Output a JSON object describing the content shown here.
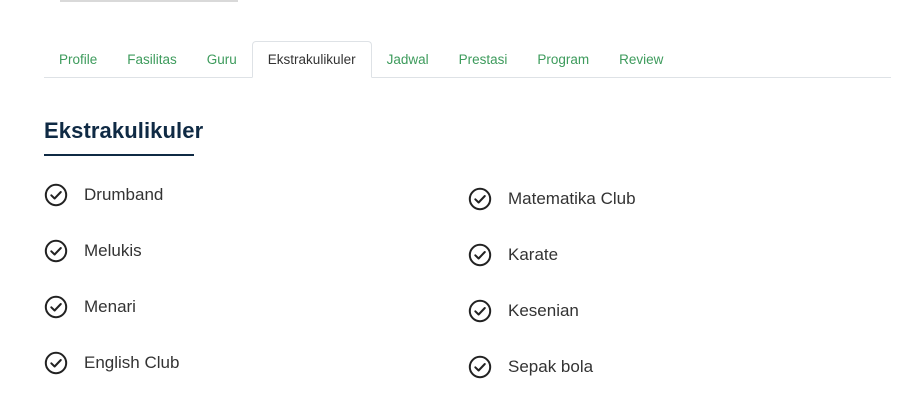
{
  "tabs": [
    {
      "label": "Profile"
    },
    {
      "label": "Fasilitas"
    },
    {
      "label": "Guru"
    },
    {
      "label": "Ekstrakulikuler",
      "active": true
    },
    {
      "label": "Jadwal"
    },
    {
      "label": "Prestasi"
    },
    {
      "label": "Program"
    },
    {
      "label": "Review"
    }
  ],
  "section": {
    "title": "Ekstrakulikuler"
  },
  "list": {
    "left": [
      {
        "label": "Drumband",
        "icon": "check-circle-icon"
      },
      {
        "label": "Melukis",
        "icon": "check-circle-icon"
      },
      {
        "label": "Menari",
        "icon": "check-circle-icon"
      },
      {
        "label": "English Club",
        "icon": "check-circle-icon"
      }
    ],
    "right": [
      {
        "label": "Matematika Club",
        "icon": "check-circle-icon"
      },
      {
        "label": "Karate",
        "icon": "check-circle-icon"
      },
      {
        "label": "Kesenian",
        "icon": "check-circle-icon"
      },
      {
        "label": "Sepak bola",
        "icon": "check-circle-icon"
      }
    ]
  },
  "colors": {
    "tab_link": "#3d9b5c",
    "tab_active_text": "#333333",
    "title": "#0f2a44",
    "item_text": "#333333",
    "icon": "#222222"
  }
}
